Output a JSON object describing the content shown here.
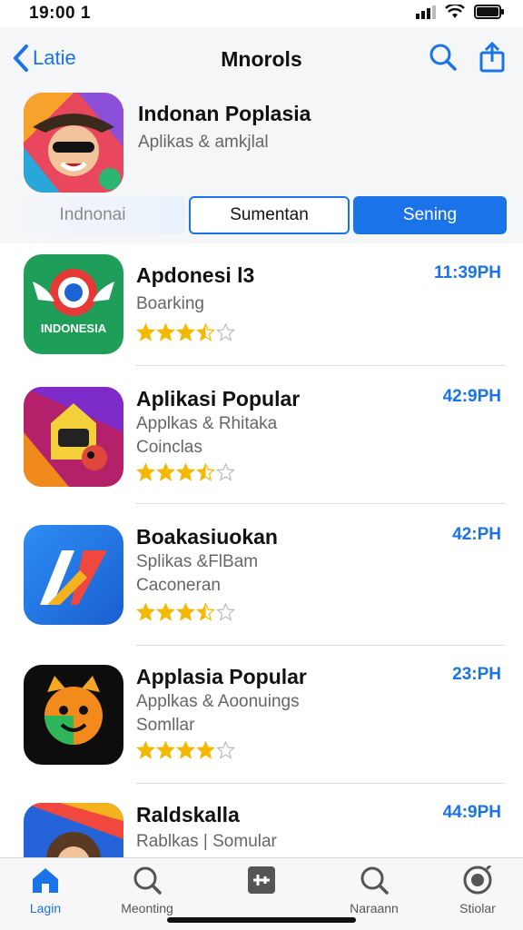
{
  "status": {
    "time": "19:00 1"
  },
  "nav": {
    "back_label": "Latie",
    "title": "Mnorols"
  },
  "featured": {
    "title": "Indonan Poplasia",
    "subtitle": "Aplikas & amkjlal"
  },
  "segments": [
    {
      "label": "Indnonai"
    },
    {
      "label": "Sumentan"
    },
    {
      "label": "Sening"
    }
  ],
  "apps": [
    {
      "name": "Apdonesi l3",
      "line1": "Boarking",
      "line2": "",
      "time": "11:39PH",
      "rating": 3.5,
      "icon_text": "INDONESIA"
    },
    {
      "name": "Aplikasi Popular",
      "line1": "Applkas & Rhitaka",
      "line2": "Coinclas",
      "time": "42:9PH",
      "rating": 3.5
    },
    {
      "name": "Boakasiuokan",
      "line1": "Splikas &FlBam",
      "line2": "Caconeran",
      "time": "42:PH",
      "rating": 3.5
    },
    {
      "name": "Applasia Popular",
      "line1": "Applkas & Aoonuings",
      "line2": "Somllar",
      "time": "23:PH",
      "rating": 4
    },
    {
      "name": "Raldskalla",
      "line1": "Rablkas | Somular",
      "line2": "",
      "time": "44:9PH",
      "rating": 0
    }
  ],
  "tabs": [
    {
      "label": "Lagin",
      "icon": "home-icon"
    },
    {
      "label": "Meonting",
      "icon": "search-icon"
    },
    {
      "label": "",
      "icon": "apps-icon"
    },
    {
      "label": "Naraann",
      "icon": "search-icon"
    },
    {
      "label": "Stiolar",
      "icon": "profile-icon"
    }
  ],
  "colors": {
    "accent": "#1a73e8",
    "star": "#f5b800"
  }
}
